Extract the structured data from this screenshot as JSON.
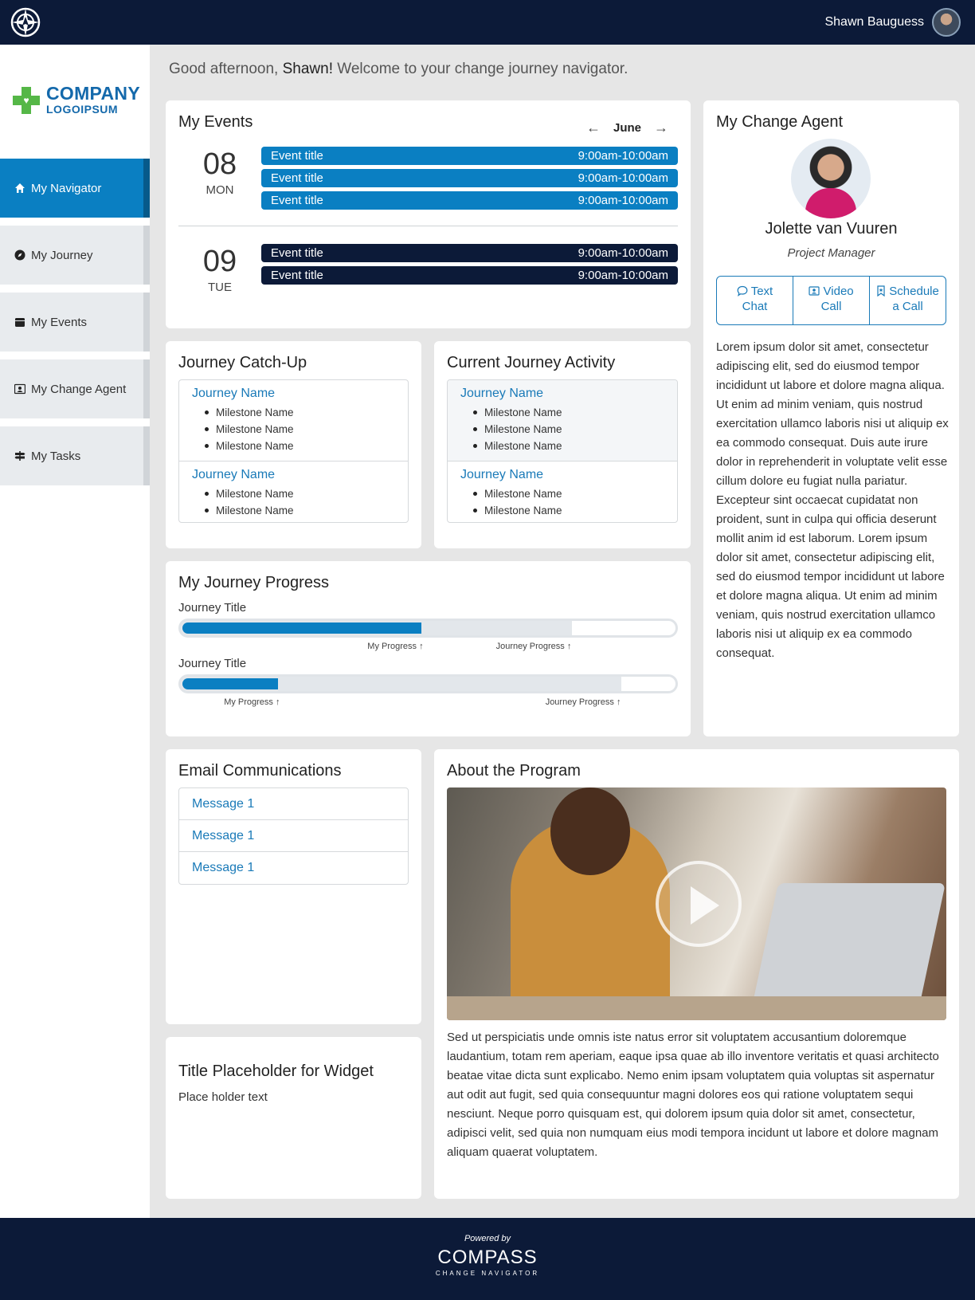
{
  "topbar": {
    "user_name": "Shawn Bauguess"
  },
  "sidebar": {
    "logo_line1": "COMPANY",
    "logo_line2": "LOGOIPSUM",
    "items": [
      {
        "label": "My Navigator",
        "icon": "home-icon",
        "active": true
      },
      {
        "label": "My Journey",
        "icon": "compass-icon",
        "active": false
      },
      {
        "label": "My Events",
        "icon": "calendar-icon",
        "active": false
      },
      {
        "label": "My Change Agent",
        "icon": "contact-card-icon",
        "active": false
      },
      {
        "label": "My Tasks",
        "icon": "signpost-icon",
        "active": false
      }
    ]
  },
  "greeting": {
    "prefix": "Good afternoon, ",
    "name": "Shawn!",
    "suffix": " Welcome to your change journey navigator."
  },
  "events": {
    "title": "My Events",
    "month": "June",
    "days": [
      {
        "num": "08",
        "name": "MON",
        "items": [
          {
            "title": "Event title",
            "time": "9:00am-10:00am"
          },
          {
            "title": "Event title",
            "time": "9:00am-10:00am"
          },
          {
            "title": "Event title",
            "time": "9:00am-10:00am"
          }
        ]
      },
      {
        "num": "09",
        "name": "TUE",
        "items": [
          {
            "title": "Event title",
            "time": "9:00am-10:00am"
          },
          {
            "title": "Event title",
            "time": "9:00am-10:00am"
          }
        ]
      }
    ]
  },
  "agent": {
    "title": "My Change Agent",
    "name": "Jolette van Vuuren",
    "role": "Project Manager",
    "actions": [
      {
        "line1": "Text",
        "line2": "Chat",
        "icon": "chat-bubble-icon"
      },
      {
        "line1": "Video",
        "line2": "Call",
        "icon": "video-contact-icon"
      },
      {
        "line1": "Schedule",
        "line2": "a Call",
        "icon": "bookmark-icon"
      }
    ],
    "bio": "Lorem ipsum dolor sit amet, consectetur adipiscing elit, sed do eiusmod tempor incididunt ut labore et dolore magna aliqua. Ut enim ad minim veniam, quis nostrud exercitation ullamco laboris nisi ut aliquip ex ea commodo consequat. Duis aute irure dolor in reprehenderit in voluptate velit esse cillum dolore eu fugiat nulla pariatur. Excepteur sint occaecat cupidatat non proident, sunt in culpa qui officia deserunt mollit anim id est laborum. Lorem ipsum dolor sit amet, consectetur adipiscing elit, sed do eiusmod tempor incididunt ut labore et dolore magna aliqua. Ut enim ad minim veniam, quis nostrud exercitation ullamco laboris nisi ut aliquip ex ea commodo consequat."
  },
  "catchup": {
    "title": "Journey Catch-Up",
    "journeys": [
      {
        "name": "Journey Name",
        "milestones": [
          "Milestone Name",
          "Milestone Name",
          "Milestone Name"
        ]
      },
      {
        "name": "Journey Name",
        "milestones": [
          "Milestone Name",
          "Milestone Name"
        ]
      }
    ]
  },
  "current": {
    "title": "Current Journey Activity",
    "journeys": [
      {
        "name": "Journey Name",
        "milestones": [
          "Milestone Name",
          "Milestone Name",
          "Milestone Name"
        ]
      },
      {
        "name": "Journey Name",
        "milestones": [
          "Milestone Name",
          "Milestone Name"
        ]
      }
    ]
  },
  "progress": {
    "title": "My Journey Progress",
    "items": [
      {
        "title": "Journey Title",
        "my_progress": 0.49,
        "journey_progress": 0.79,
        "my_label": "My Progress ↑",
        "journey_label": "Journey Progress ↑"
      },
      {
        "title": "Journey Title",
        "my_progress": 0.2,
        "journey_progress": 0.89,
        "my_label": "My Progress ↑",
        "journey_label": "Journey Progress ↑"
      }
    ]
  },
  "email": {
    "title": "Email Communications",
    "messages": [
      "Message 1",
      "Message 1",
      "Message 1"
    ]
  },
  "placeholder_widget": {
    "title": "Title Placeholder for Widget",
    "text": "Place holder text"
  },
  "about": {
    "title": "About the Program",
    "text": "Sed ut perspiciatis unde omnis iste natus error sit voluptatem accusantium doloremque laudantium, totam rem aperiam, eaque ipsa quae ab illo inventore veritatis et quasi architecto beatae vitae dicta sunt explicabo. Nemo enim ipsam voluptatem quia voluptas sit aspernatur aut odit aut fugit, sed quia consequuntur magni dolores eos qui ratione voluptatem sequi nesciunt. Neque porro quisquam est, qui dolorem ipsum quia dolor sit amet, consectetur, adipisci velit, sed quia non numquam eius modi tempora incidunt ut labore et dolore magnam aliquam quaerat voluptatem."
  },
  "footer": {
    "powered_by": "Powered by",
    "brand": "COMPASS",
    "brand_sub": "CHANGE NAVIGATOR"
  },
  "colors": {
    "navy": "#0c1a38",
    "accent_blue": "#0a7fc2",
    "link_blue": "#1a7ab8",
    "logo_green": "#55b747"
  }
}
